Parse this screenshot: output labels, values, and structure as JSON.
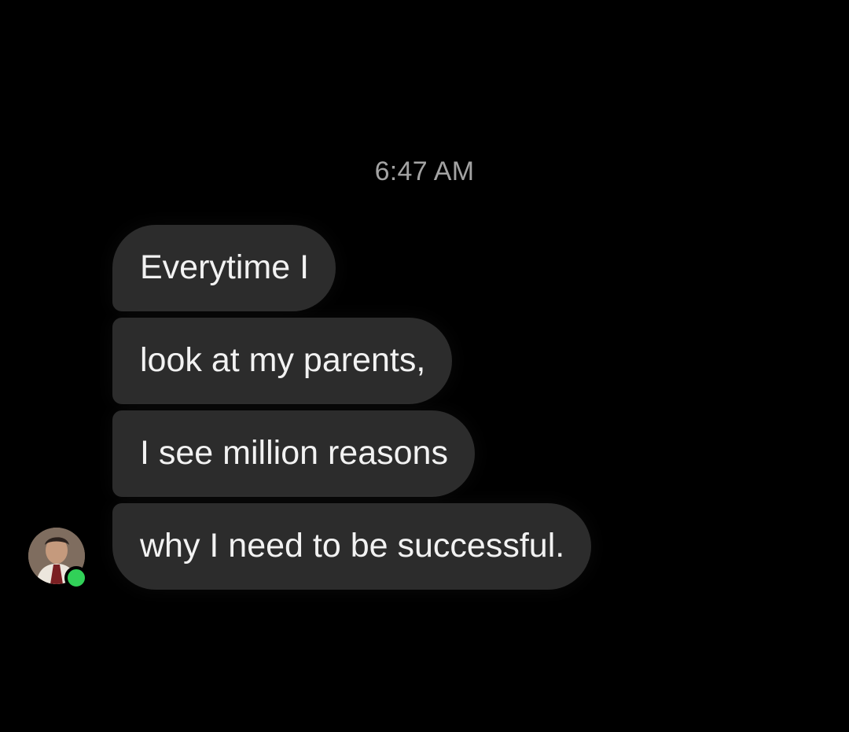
{
  "conversation": {
    "timestamp": "6:47 AM",
    "messages": [
      {
        "text": "Everytime I"
      },
      {
        "text": "look at my parents,"
      },
      {
        "text": "I see million reasons"
      },
      {
        "text": "why I need to be successful."
      }
    ],
    "sender": {
      "avatar_icon": "contact-avatar",
      "presence": "online",
      "presence_color": "#31d158"
    }
  },
  "colors": {
    "background": "#000000",
    "bubble": "#2c2c2c",
    "bubble_text": "#f2f2f2",
    "timestamp_text": "#a3a3a3"
  }
}
